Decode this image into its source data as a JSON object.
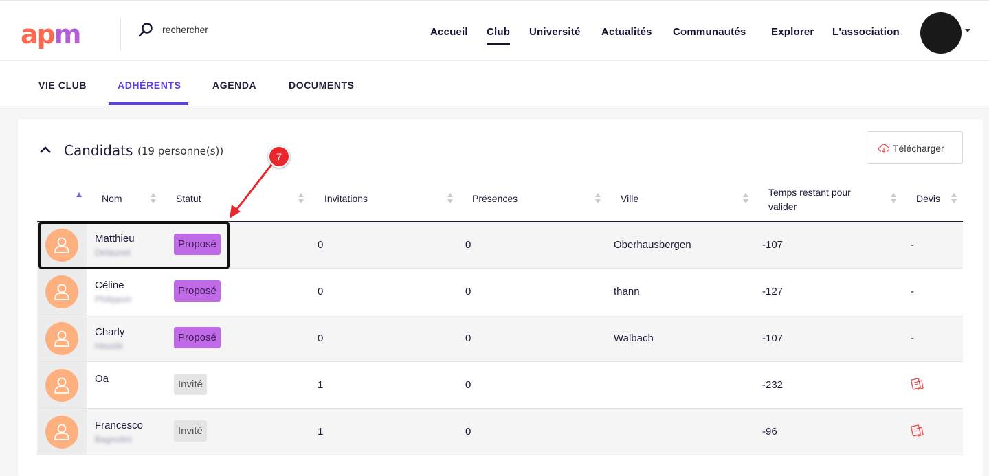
{
  "header": {
    "logo": {
      "part1": "ap",
      "part2": "m"
    },
    "search_placeholder": "rechercher",
    "nav": [
      {
        "label": "Accueil",
        "active": false
      },
      {
        "label": "Club",
        "active": true
      },
      {
        "label": "Université",
        "active": false
      },
      {
        "label": "Actualités",
        "active": false
      },
      {
        "label": "Communautés",
        "active": false
      },
      {
        "label": "Explorer",
        "active": false
      },
      {
        "label": "L'association",
        "active": false
      }
    ]
  },
  "subnav": {
    "tabs": [
      {
        "label": "VIE CLUB",
        "active": false
      },
      {
        "label": "ADHÉRENTS",
        "active": true
      },
      {
        "label": "AGENDA",
        "active": false
      },
      {
        "label": "DOCUMENTS",
        "active": false
      }
    ]
  },
  "section": {
    "title": "Candidats",
    "count": "(19 personne(s))",
    "download_label": "Télécharger"
  },
  "table": {
    "columns": [
      "Nom",
      "Statut",
      "Invitations",
      "Présences",
      "Ville",
      "Temps restant pour valider",
      "Devis"
    ],
    "rows": [
      {
        "first_name": "Matthieu",
        "last_name": "Delaunet",
        "status": "Proposé",
        "status_type": "proposed",
        "invitations": "0",
        "presences": "0",
        "city": "Oberhausbergen",
        "remaining": "-107",
        "devis": "-"
      },
      {
        "first_name": "Céline",
        "last_name": "Philippon",
        "status": "Proposé",
        "status_type": "proposed",
        "invitations": "0",
        "presences": "0",
        "city": "thann",
        "remaining": "-127",
        "devis": "-"
      },
      {
        "first_name": "Charly",
        "last_name": "Heuslé",
        "status": "Proposé",
        "status_type": "proposed",
        "invitations": "0",
        "presences": "0",
        "city": "Walbach",
        "remaining": "-107",
        "devis": "-"
      },
      {
        "first_name": "Oa",
        "last_name": "",
        "status": "Invité",
        "status_type": "invited",
        "invitations": "1",
        "presences": "0",
        "city": "",
        "remaining": "-232",
        "devis": "icon"
      },
      {
        "first_name": "Francesco",
        "last_name": "Bagnolini",
        "status": "Invité",
        "status_type": "invited",
        "invitations": "1",
        "presences": "0",
        "city": "",
        "remaining": "-96",
        "devis": "icon"
      }
    ]
  },
  "annotation": {
    "marker_number": "7"
  },
  "colors": {
    "accent": "#5b3df5",
    "proposed_badge": "#c06ae8",
    "invited_badge": "#e4e4e4",
    "avatar": "#ffb07f",
    "marker": "#e8262b"
  }
}
